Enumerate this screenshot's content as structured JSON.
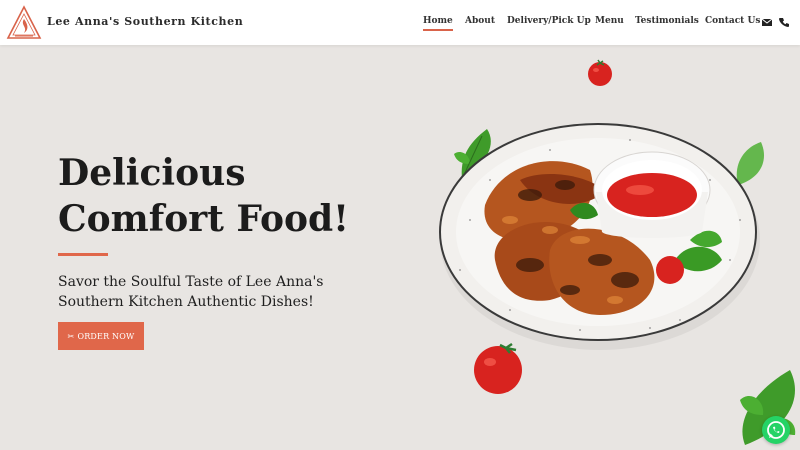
{
  "header": {
    "brand": "Lee Anna's Southern Kitchen",
    "nav": [
      {
        "label": "Home",
        "active": true
      },
      {
        "label": "About"
      },
      {
        "label": "Delivery/Pick Up"
      },
      {
        "label": "Menu"
      },
      {
        "label": "Testimonials"
      },
      {
        "label": "Contact Us"
      }
    ],
    "icons": [
      "envelope-icon",
      "phone-icon"
    ]
  },
  "hero": {
    "title_line1": "Delicious",
    "title_line2": "Comfort Food!",
    "subtitle_line1": "Savor the Soulful Taste of Lee Anna's",
    "subtitle_line2": "Southern Kitchen Authentic Dishes!",
    "cta_label": "ORDER NOW",
    "cta_icon": "✂"
  },
  "colors": {
    "accent": "#e0674a",
    "background": "#e8e5e2",
    "whatsapp": "#25d366"
  }
}
